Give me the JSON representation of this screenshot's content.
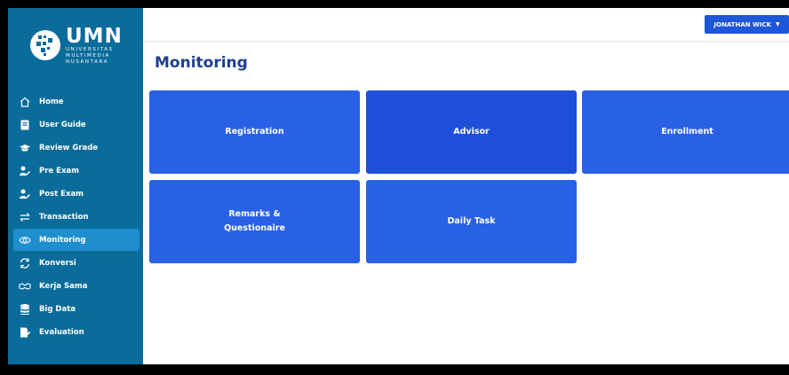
{
  "brand": {
    "name": "UMN",
    "line1": "UNIVERSITAS",
    "line2": "MULTIMEDIA",
    "line3": "NUSANTARA"
  },
  "sidebar": {
    "items": [
      {
        "label": "Home",
        "icon": "home-icon",
        "active": false
      },
      {
        "label": "User Guide",
        "icon": "book-icon",
        "active": false
      },
      {
        "label": "Review Grade",
        "icon": "graduation-cap-icon",
        "active": false
      },
      {
        "label": "Pre Exam",
        "icon": "user-edit-icon",
        "active": false
      },
      {
        "label": "Post Exam",
        "icon": "user-edit-icon",
        "active": false
      },
      {
        "label": "Transaction",
        "icon": "exchange-icon",
        "active": false
      },
      {
        "label": "Monitoring",
        "icon": "eye-icon",
        "active": true
      },
      {
        "label": "Konversi",
        "icon": "sync-icon",
        "active": false
      },
      {
        "label": "Kerja Sama",
        "icon": "handshake-icon",
        "active": false
      },
      {
        "label": "Big Data",
        "icon": "database-icon",
        "active": false
      },
      {
        "label": "Evaluation",
        "icon": "file-edit-icon",
        "active": false
      }
    ]
  },
  "header": {
    "user_label": "JONATHAN WICK",
    "caret": "▼"
  },
  "main": {
    "title": "Monitoring",
    "cards": [
      {
        "label": "Registration"
      },
      {
        "label": "Advisor"
      },
      {
        "label": "Enrollment"
      },
      {
        "label_line1": "Remarks &",
        "label_line2": "Questionaire"
      },
      {
        "label": "Daily Task"
      }
    ]
  },
  "colors": {
    "sidebar": "#0a6c9a",
    "sidebar_active": "#1e8fcc",
    "card": "#2861e6",
    "card_dark": "#1d4fd8",
    "title": "#1d3f8f",
    "button": "#1d56d8"
  }
}
